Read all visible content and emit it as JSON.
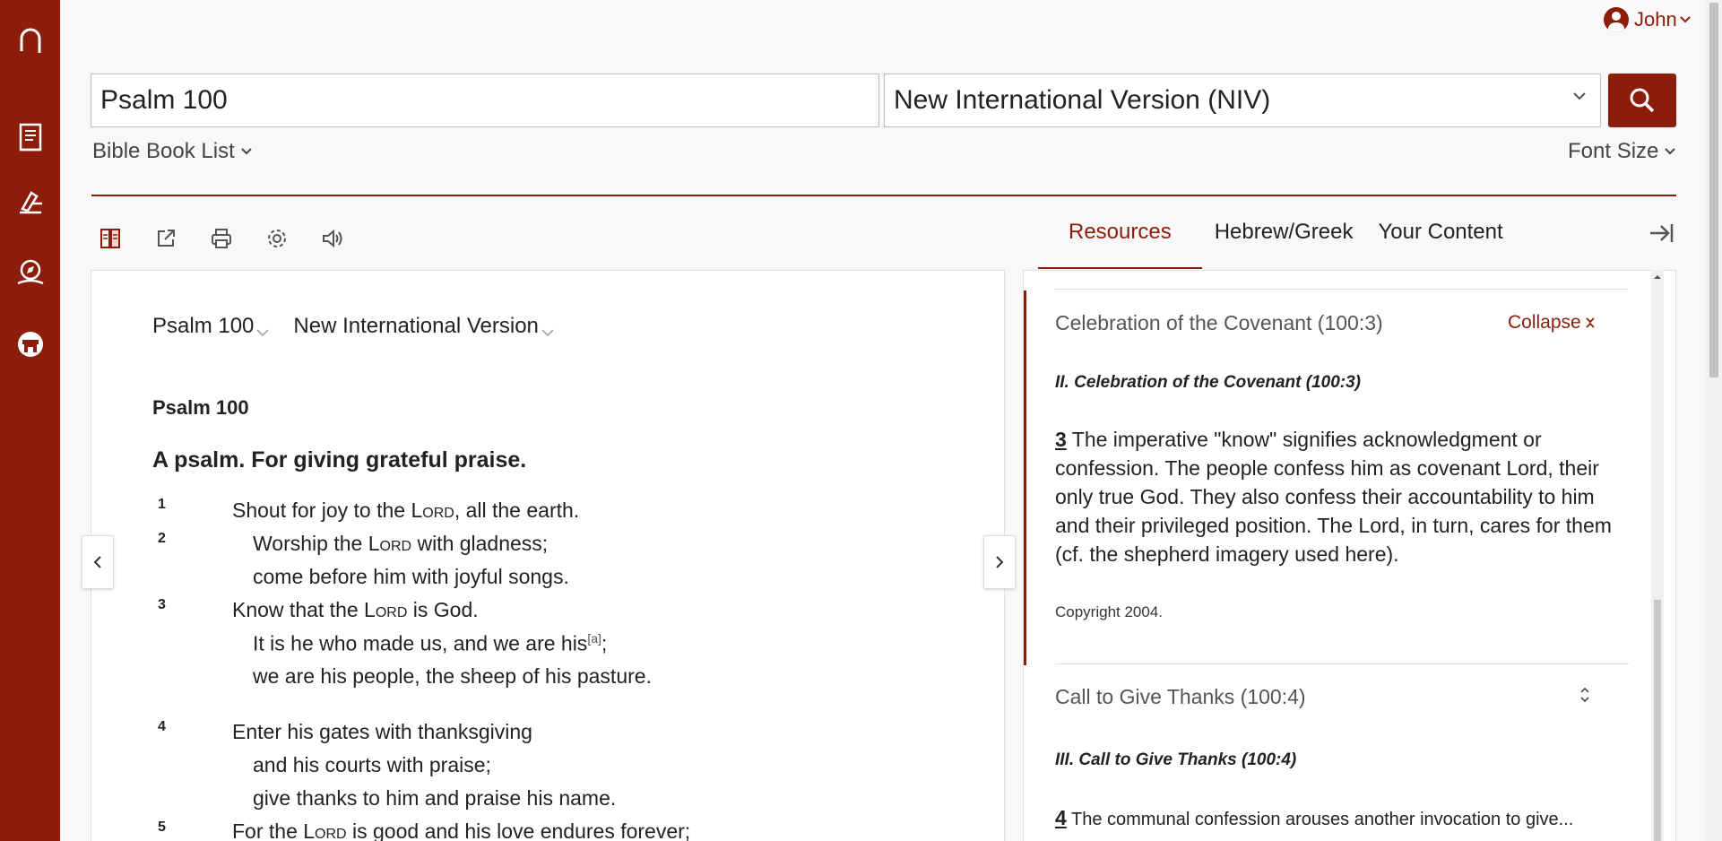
{
  "user": {
    "name": "John"
  },
  "search": {
    "query": "Psalm 100",
    "version": "New International Version (NIV)"
  },
  "controls": {
    "book_list": "Bible Book List",
    "font_size": "Font Size"
  },
  "reader": {
    "passage_select": "Psalm 100",
    "version_select": "New International Version",
    "passage_ref": "Psalm 100",
    "title": "A psalm. For giving grateful praise.",
    "verse_numbers": [
      "1",
      "2",
      "3",
      "4",
      "5"
    ],
    "lines": [
      {
        "pre": "Shout for joy to the ",
        "sc": "Lord",
        "post": ", all the earth."
      },
      {
        "pre": "Worship the ",
        "sc": "Lord",
        "post": " with gladness;"
      },
      {
        "text": "come before him with joyful songs."
      },
      {
        "pre": "Know that the ",
        "sc": "Lord",
        "post": " is God."
      },
      {
        "pre": "It is he who made us, and we are his",
        "foot": "[a]",
        "post2": ";"
      },
      {
        "text": "we are his people, the sheep of his pasture."
      },
      {
        "text": "Enter his gates with thanksgiving"
      },
      {
        "text": "and his courts with praise;"
      },
      {
        "text": "give thanks to him and praise his name."
      },
      {
        "pre": "For the ",
        "sc": "Lord",
        "post": " is good and his love endures forever;"
      }
    ]
  },
  "panel": {
    "tabs": [
      "Resources",
      "Hebrew/Greek",
      "Your Content"
    ],
    "active_tab": "Resources",
    "section1": {
      "heading": "Celebration of the Covenant (100:3)",
      "collapse_label": "Collapse",
      "subheading": "II. Celebration of the Covenant (100:3)",
      "verse_ref": "3",
      "body": "The imperative \"know\" signifies acknowledgment or confession. The people confess him as covenant Lord, their only true God. They also confess their accountability to him and their privileged position. The Lord, in turn, cares for them (cf. the shepherd imagery used here).",
      "copyright": "Copyright 2004."
    },
    "section2": {
      "heading": "Call to Give Thanks (100:4)",
      "subheading": "III. Call to Give Thanks (100:4)",
      "verse_ref": "4",
      "body": "The communal confession arouses another invocation to give..."
    }
  },
  "colors": {
    "brand": "#8c1d0b"
  },
  "icons": [
    "logo-icon",
    "book-icon",
    "study-icon",
    "explore-icon",
    "store-icon",
    "user-icon",
    "search-icon",
    "parallel-icon",
    "share-icon",
    "print-icon",
    "settings-icon",
    "audio-icon"
  ]
}
